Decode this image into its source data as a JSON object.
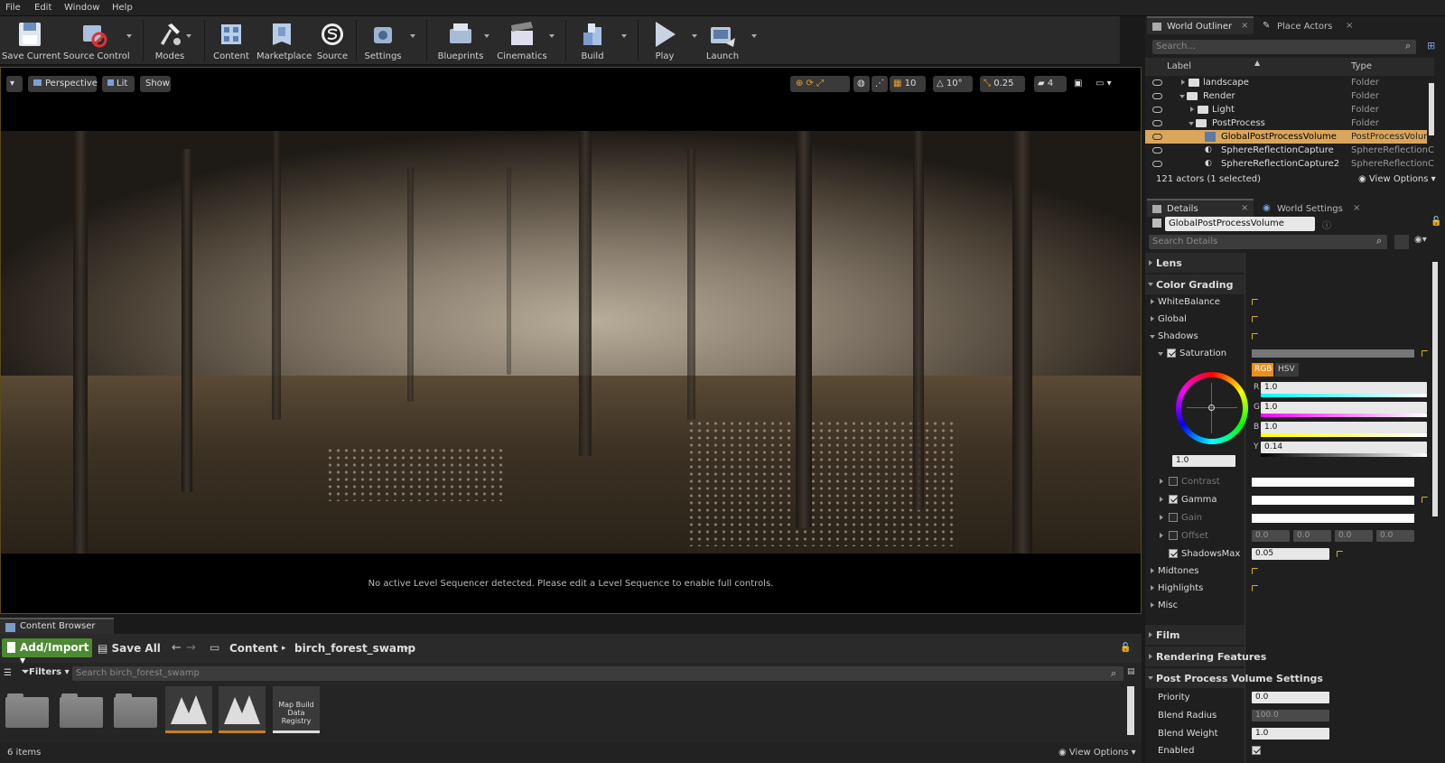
{
  "menu": {
    "file": "File",
    "edit": "Edit",
    "window": "Window",
    "help": "Help"
  },
  "toolbar": {
    "save_current": "Save Current",
    "source_control": "Source Control",
    "modes": "Modes",
    "content": "Content",
    "marketplace": "Marketplace",
    "source": "Source",
    "settings": "Settings",
    "blueprints": "Blueprints",
    "cinematics": "Cinematics",
    "build": "Build",
    "play": "Play",
    "launch": "Launch"
  },
  "viewport": {
    "perspective": "Perspective",
    "lit": "Lit",
    "show": "Show",
    "grid_snap": "10",
    "rot_snap": "10°",
    "scale_snap": "0.25",
    "cam_speed": "4",
    "sequencer_msg": "No active Level Sequencer detected. Please edit a Level Sequence to enable full controls."
  },
  "content_browser": {
    "tab": "Content Browser",
    "add_import": "Add/Import",
    "save_all": "Save All",
    "path": [
      "Content",
      "birch_forest_swamp"
    ],
    "filters": "Filters",
    "search_placeholder": "Search birch_forest_swamp",
    "asset_label": "Map Build Data Registry",
    "items_count": "6 items",
    "view_options": "View Options"
  },
  "outliner": {
    "tab": "World Outliner",
    "tab2": "Place Actors",
    "search_placeholder": "Search...",
    "col_label": "Label",
    "col_type": "Type",
    "rows": [
      {
        "label": "landscape",
        "type": "Folder"
      },
      {
        "label": "Render",
        "type": "Folder"
      },
      {
        "label": "Light",
        "type": "Folder"
      },
      {
        "label": "PostProcess",
        "type": "Folder"
      },
      {
        "label": "GlobalPostProcessVolume",
        "type": "PostProcessVolum"
      },
      {
        "label": "SphereReflectionCapture",
        "type": "SphereReflectionC"
      },
      {
        "label": "SphereReflectionCapture2",
        "type": "SphereReflectionC"
      }
    ],
    "status": "121 actors (1 selected)",
    "view_options": "View Options"
  },
  "details": {
    "tab": "Details",
    "tab2": "World Settings",
    "actor_name": "GlobalPostProcessVolume",
    "search_placeholder": "Search Details",
    "lens": "Lens",
    "color_grading": "Color Grading",
    "white_balance": "WhiteBalance",
    "global": "Global",
    "shadows": "Shadows",
    "saturation": "Saturation",
    "rgb": "RGB",
    "hsv": "HSV",
    "r_lbl": "R",
    "g_lbl": "G",
    "b_lbl": "B",
    "y_lbl": "Y",
    "r": "1.0",
    "g": "1.0",
    "b": "1.0",
    "y": "0.14",
    "wheel_value": "1.0",
    "contrast": "Contrast",
    "gamma": "Gamma",
    "gain": "Gain",
    "offset": "Offset",
    "offset_vals": [
      "0.0",
      "0.0",
      "0.0",
      "0.0"
    ],
    "shadows_max": "ShadowsMax",
    "shadows_max_val": "0.05",
    "midtones": "Midtones",
    "highlights": "Highlights",
    "misc": "Misc",
    "film": "Film",
    "rendering_features": "Rendering Features",
    "ppv_settings": "Post Process Volume Settings",
    "priority": "Priority",
    "priority_val": "0.0",
    "blend_radius": "Blend Radius",
    "blend_radius_val": "100.0",
    "blend_weight": "Blend Weight",
    "blend_weight_val": "1.0",
    "enabled": "Enabled"
  }
}
